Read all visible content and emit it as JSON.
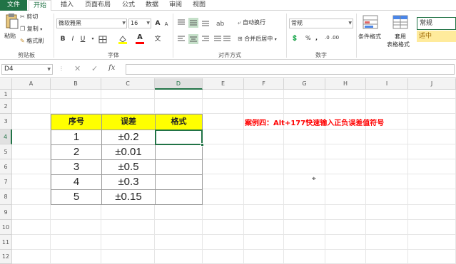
{
  "tabs": [
    "文件",
    "开始",
    "插入",
    "页面布局",
    "公式",
    "数据",
    "审阅",
    "视图"
  ],
  "clipboard": {
    "cut": "剪切",
    "copy": "复制",
    "format_painter": "格式刷",
    "paste": "粘贴",
    "group": "剪贴板"
  },
  "font": {
    "name": "微软雅黑",
    "size": "16",
    "group": "字体",
    "bold": "B",
    "italic": "I",
    "underline": "U",
    "inc": "A",
    "dec": "A",
    "wen": "文"
  },
  "alignment": {
    "wrap": "自动换行",
    "merge": "合并后居中",
    "group": "对齐方式"
  },
  "number": {
    "format": "常规",
    "group": "数字",
    "percent": "%",
    "comma": ",",
    "inc_dec": ".0 .00"
  },
  "styles": {
    "cond_format": "条件格式",
    "table_format_1": "套用",
    "table_format_2": "表格格式",
    "normal": "常规",
    "good": "适中"
  },
  "formula_bar": {
    "name_box": "D4",
    "cancel": "✕",
    "confirm": "✓",
    "fx": "fx"
  },
  "columns": [
    "A",
    "B",
    "C",
    "D",
    "E",
    "F",
    "G",
    "H",
    "I",
    "J"
  ],
  "rows": [
    "1",
    "2",
    "3",
    "4",
    "5",
    "6",
    "7",
    "8",
    "9",
    "10",
    "11",
    "12"
  ],
  "table": {
    "headers": [
      "序号",
      "误差",
      "格式"
    ],
    "rows": [
      {
        "no": "1",
        "err": "±0.2",
        "fmt": ""
      },
      {
        "no": "2",
        "err": "±0.01",
        "fmt": ""
      },
      {
        "no": "3",
        "err": "±0.5",
        "fmt": ""
      },
      {
        "no": "4",
        "err": "±0.3",
        "fmt": ""
      },
      {
        "no": "5",
        "err": "±0.15",
        "fmt": ""
      }
    ]
  },
  "note": "案例四：Alt+177快速输入正负误差值符号",
  "colors": {
    "accent": "#217346",
    "header_fill": "#ffff00",
    "note": "#ff0000",
    "good_fill": "#ffeb9c",
    "good_text": "#9c6500"
  }
}
